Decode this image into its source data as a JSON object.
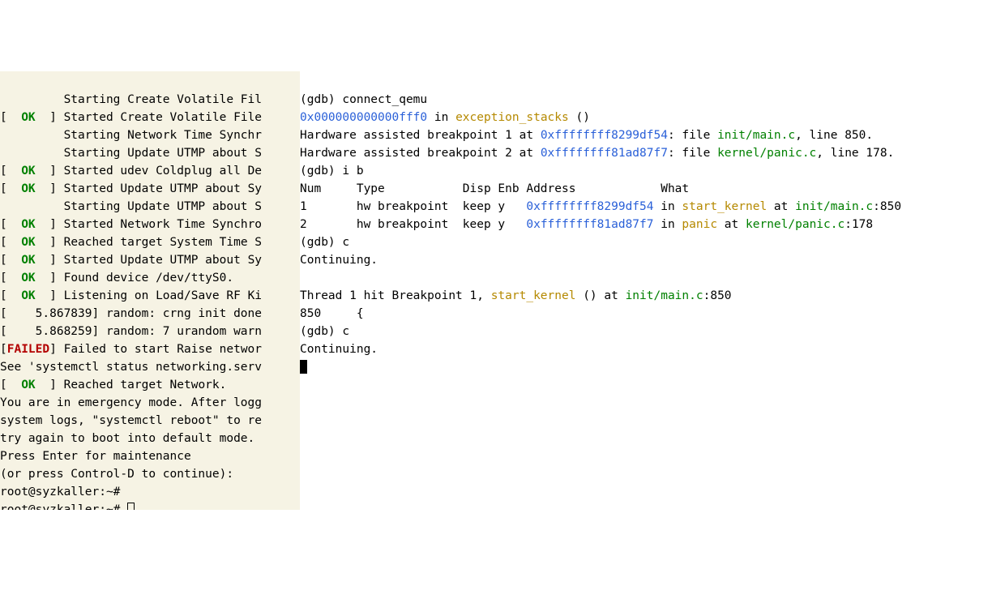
{
  "left": {
    "l01": "         Starting Create Volatile Fil",
    "l02a": "[  ",
    "l02ok": "OK",
    "l02b": "  ] Started Create Volatile File",
    "l03": "         Starting Network Time Synchr",
    "l04": "         Starting Update UTMP about S",
    "l05a": "[  ",
    "l05ok": "OK",
    "l05b": "  ] Started udev Coldplug all De",
    "l06a": "[  ",
    "l06ok": "OK",
    "l06b": "  ] Started Update UTMP about Sy",
    "l07": "         Starting Update UTMP about S",
    "l08a": "[  ",
    "l08ok": "OK",
    "l08b": "  ] Started Network Time Synchro",
    "l09a": "[  ",
    "l09ok": "OK",
    "l09b": "  ] Reached target System Time S",
    "l10a": "[  ",
    "l10ok": "OK",
    "l10b": "  ] Started Update UTMP about Sy",
    "l11a": "[  ",
    "l11ok": "OK",
    "l11b": "  ] Found device /dev/ttyS0.",
    "l12a": "[  ",
    "l12ok": "OK",
    "l12b": "  ] Listening on Load/Save RF Ki",
    "l13": "[    5.867839] random: crng init done",
    "l14": "[    5.868259] random: 7 urandom warn",
    "l15a": "[",
    "l15fail": "FAILED",
    "l15b": "] Failed to start Raise networ",
    "l16": "See 'systemctl status networking.serv",
    "l17a": "[  ",
    "l17ok": "OK",
    "l17b": "  ] Reached target Network.",
    "l18": "You are in emergency mode. After logg",
    "l19": "system logs, \"systemctl reboot\" to re",
    "l20": "try again to boot into default mode.",
    "l21": "Press Enter for maintenance",
    "l22": "(or press Control-D to continue):",
    "l23": "root@syzkaller:~#",
    "l24": "root@syzkaller:~# "
  },
  "right": {
    "r01": "(gdb) connect_qemu",
    "r02_addr": "0x000000000000fff0",
    "r02_mid": " in ",
    "r02_fn": "exception_stacks",
    "r02_tail": " ()",
    "r03_a": "Hardware assisted breakpoint 1 at ",
    "r03_addr": "0xffffffff8299df54",
    "r03_b": ": file ",
    "r03_file": "init/main.c",
    "r03_c": ", line 850.",
    "r04_a": "Hardware assisted breakpoint 2 at ",
    "r04_addr": "0xffffffff81ad87f7",
    "r04_b": ": file ",
    "r04_file": "kernel/panic.c",
    "r04_c": ", line 178.",
    "r05": "(gdb) i b",
    "r06": "Num     Type           Disp Enb Address            What",
    "r07_a": "1       hw breakpoint  keep y   ",
    "r07_addr": "0xffffffff8299df54",
    "r07_b": " in ",
    "r07_fn": "start_kernel",
    "r07_c": " at ",
    "r07_file": "init/main.c",
    "r07_d": ":850",
    "r08_a": "2       hw breakpoint  keep y   ",
    "r08_addr": "0xffffffff81ad87f7",
    "r08_b": " in ",
    "r08_fn": "panic",
    "r08_c": " at ",
    "r08_file": "kernel/panic.c",
    "r08_d": ":178",
    "r09": "(gdb) c",
    "r10": "Continuing.",
    "r11": "",
    "r12_a": "Thread 1 hit Breakpoint 1, ",
    "r12_fn": "start_kernel",
    "r12_b": " () at ",
    "r12_file": "init/main.c",
    "r12_c": ":850",
    "r13": "850     {",
    "r14": "(gdb) c",
    "r15": "Continuing."
  }
}
